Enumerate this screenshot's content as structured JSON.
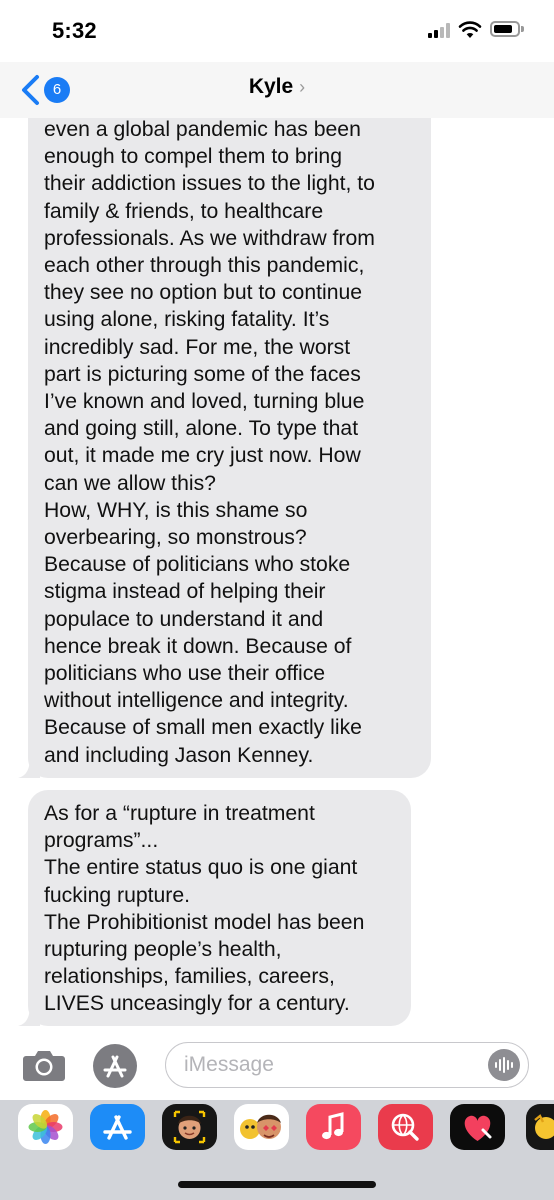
{
  "status_bar": {
    "time": "5:32"
  },
  "nav": {
    "back_count": "6",
    "contact_name": "Kyle",
    "contact_chevron": "›"
  },
  "conversation": {
    "messages": [
      {
        "lines": [
          "even a global pandemic has been",
          "enough to compel them to bring",
          "their addiction issues to the light, to",
          "family & friends, to healthcare",
          "professionals. As we withdraw from",
          "each other through this pandemic,",
          "they see no option but to continue",
          "using alone, risking fatality. It’s",
          "incredibly sad. For me, the worst",
          "part is picturing some of the faces",
          "I’ve known and loved, turning blue",
          "and going still, alone. To type that",
          "out, it made me cry just now. How",
          "can we allow this?",
          "How, WHY, is this shame so",
          "overbearing, so monstrous?",
          "Because of politicians who stoke",
          "stigma instead of helping their",
          "populace to understand it and",
          "hence break it down. Because of",
          "politicians who use their office",
          "without intelligence and integrity.",
          "Because of small men exactly like",
          "and including Jason Kenney."
        ]
      },
      {
        "lines": [
          "As for a “rupture in treatment",
          "programs”...",
          "The entire status quo is one giant",
          "fucking rupture.",
          "The Prohibitionist model has been",
          "rupturing people’s health,",
          "relationships, families, careers,",
          "LIVES unceasingly for a century."
        ]
      }
    ]
  },
  "input": {
    "placeholder": "iMessage"
  },
  "drawer": {
    "apps": [
      {
        "name": "photos-app-icon"
      },
      {
        "name": "app-store-app-icon"
      },
      {
        "name": "memoji-app-icon"
      },
      {
        "name": "memoji-stickers-app-icon"
      },
      {
        "name": "music-app-icon"
      },
      {
        "name": "images-search-app-icon"
      },
      {
        "name": "digital-touch-app-icon"
      },
      {
        "name": "animoji-app-icon"
      }
    ]
  },
  "colors": {
    "accent": "#1a7cf5",
    "bubble_received": "#e9e9eb",
    "drawer_background": "#d1d3d8"
  }
}
